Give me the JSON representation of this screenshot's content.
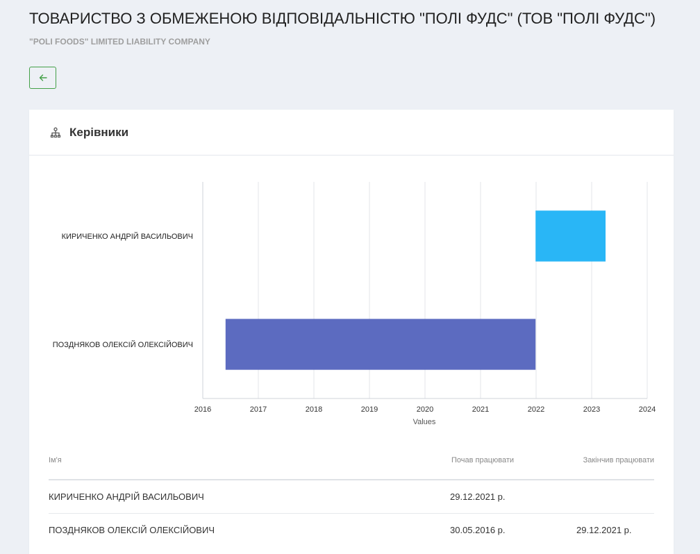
{
  "header": {
    "title": "ТОВАРИСТВО З ОБМЕЖЕНОЮ ВІДПОВІДАЛЬНІСТЮ \"ПОЛІ ФУДС\" (ТОВ \"ПОЛІ ФУДС\")",
    "subtitle": "\"POLI FOODS\" LIMITED LIABILITY COMPANY",
    "back_icon": "arrow-left-icon"
  },
  "section": {
    "title": "Керівники",
    "icon": "org-structure-icon"
  },
  "chart_data": {
    "type": "bar",
    "orientation": "horizontal-range",
    "xlabel": "Values",
    "xlim": [
      2016,
      2024
    ],
    "x_ticks": [
      "2016",
      "2017",
      "2018",
      "2019",
      "2020",
      "2021",
      "2022",
      "2023",
      "2024"
    ],
    "grid": true,
    "categories": [
      "КИРИЧЕНКО АНДРІЙ ВАСИЛЬОВИЧ",
      "ПОЗДНЯКОВ ОЛЕКСІЙ ОЛЕКСІЙОВИЧ"
    ],
    "series": [
      {
        "values": [
          [
            2021.99,
            2023.25
          ],
          [
            2016.41,
            2021.99
          ]
        ],
        "colors": [
          "#29b6f6",
          "#5c6bc0"
        ]
      }
    ]
  },
  "table": {
    "headers": [
      "Ім'я",
      "Почав працювати",
      "Закінчив працювати"
    ],
    "rows": [
      {
        "name": "КИРИЧЕНКО АНДРІЙ ВАСИЛЬОВИЧ",
        "start": "29.12.2021 р.",
        "end": ""
      },
      {
        "name": "ПОЗДНЯКОВ ОЛЕКСІЙ ОЛЕКСІЙОВИЧ",
        "start": "30.05.2016 р.",
        "end": "29.12.2021 р."
      }
    ]
  },
  "colors": {
    "background": "#edf0f5",
    "accent_green": "#43a047"
  }
}
